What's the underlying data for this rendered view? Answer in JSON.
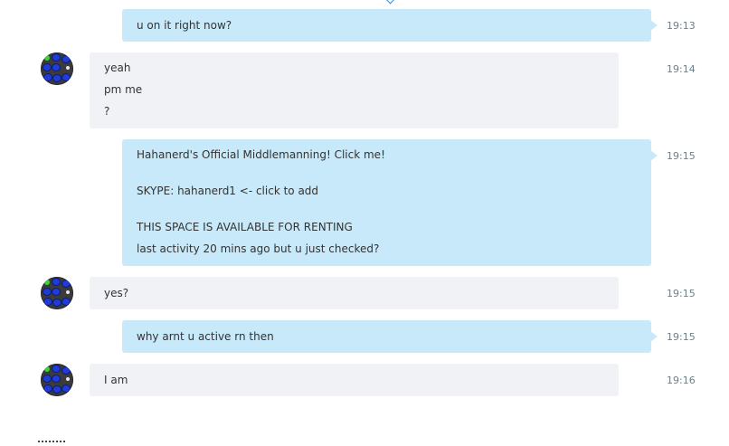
{
  "messages": [
    {
      "direction": "out",
      "lines": [
        "u on it right now?"
      ],
      "time": "19:13"
    },
    {
      "direction": "in",
      "lines": [
        "yeah",
        "pm me",
        "?"
      ],
      "time": "19:14"
    },
    {
      "direction": "out",
      "lines": [
        "Hahanerd's Official Middlemanning! Click me!",
        "SKYPE: hahanerd1 <- click to add",
        "THIS SPACE IS AVAILABLE FOR RENTING",
        "last activity 20 mins ago but u just checked?"
      ],
      "time": "19:15"
    },
    {
      "direction": "in",
      "lines": [
        "yes?"
      ],
      "time": "19:15"
    },
    {
      "direction": "out",
      "lines": [
        "why arnt u active rn then"
      ],
      "time": "19:15"
    },
    {
      "direction": "in",
      "lines": [
        "I am"
      ],
      "time": "19:16"
    }
  ],
  "colors": {
    "outgoing_bubble": "#c7e9f9",
    "incoming_bubble": "#f1f2f5",
    "timestamp": "#6b7f8c",
    "avatar_blue": "#1f3cd6",
    "avatar_green": "#3fd13a"
  },
  "icons": {
    "contact_avatar": "contact-avatar-icon"
  }
}
